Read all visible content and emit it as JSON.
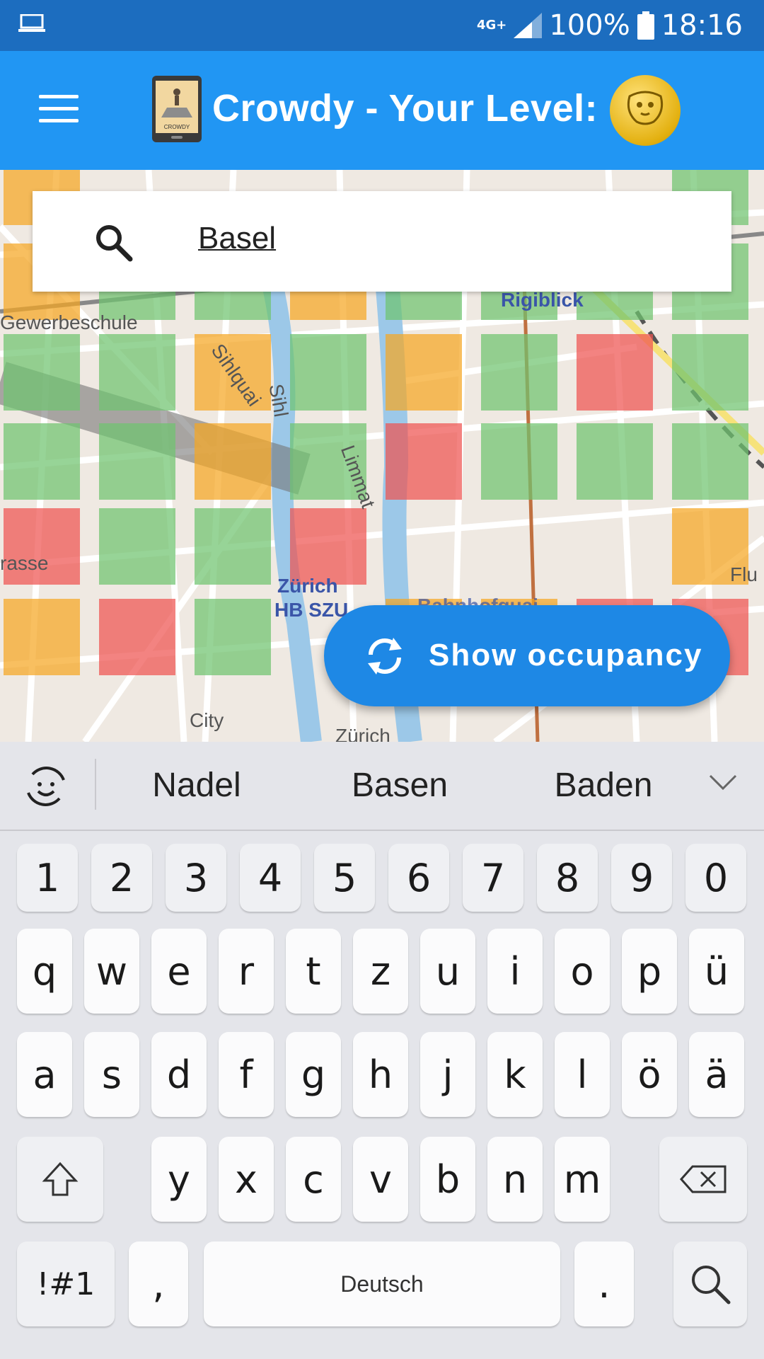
{
  "status_bar": {
    "network": "4G+",
    "battery_percent": "100%",
    "time": "18:16"
  },
  "app_bar": {
    "title": "Crowdy - Your Level:",
    "menu_icon": "hamburger-menu-icon",
    "logo_icon": "crowdy-logo-icon",
    "logo_text": "CROWDY",
    "level_icon": "sloth-badge-icon"
  },
  "search": {
    "value": "Basel",
    "icon": "search-icon"
  },
  "map": {
    "labels": {
      "gewerbeschule": "Gewerbeschule",
      "rigiblick": "Rigiblick",
      "sihlquai": "Sihlquai",
      "sihl": "Sihl",
      "limmat": "Limmat",
      "rasse": "rasse",
      "zurich": "Zürich",
      "hb_szu": "HB SZU",
      "city": "City",
      "zurich_bottom": "Zürich",
      "fl": "Flu",
      "bahnhof": "Bahnhofquai"
    },
    "occupancy_colors": {
      "low": "#6fc36f",
      "medium": "#f5a623",
      "high": "#ef5350"
    }
  },
  "fab": {
    "label": "Show occupancy",
    "icon": "refresh-icon"
  },
  "keyboard": {
    "suggestions": [
      "Nadel",
      "Basen",
      "Baden"
    ],
    "number_row": [
      "1",
      "2",
      "3",
      "4",
      "5",
      "6",
      "7",
      "8",
      "9",
      "0"
    ],
    "row1": [
      "q",
      "w",
      "e",
      "r",
      "t",
      "z",
      "u",
      "i",
      "o",
      "p",
      "ü"
    ],
    "row2": [
      "a",
      "s",
      "d",
      "f",
      "g",
      "h",
      "j",
      "k",
      "l",
      "ö",
      "ä"
    ],
    "row3": [
      "y",
      "x",
      "c",
      "v",
      "b",
      "n",
      "m"
    ],
    "symbols_key": "!#1",
    "comma_key": ",",
    "space_label": "Deutsch",
    "period_key": "."
  }
}
